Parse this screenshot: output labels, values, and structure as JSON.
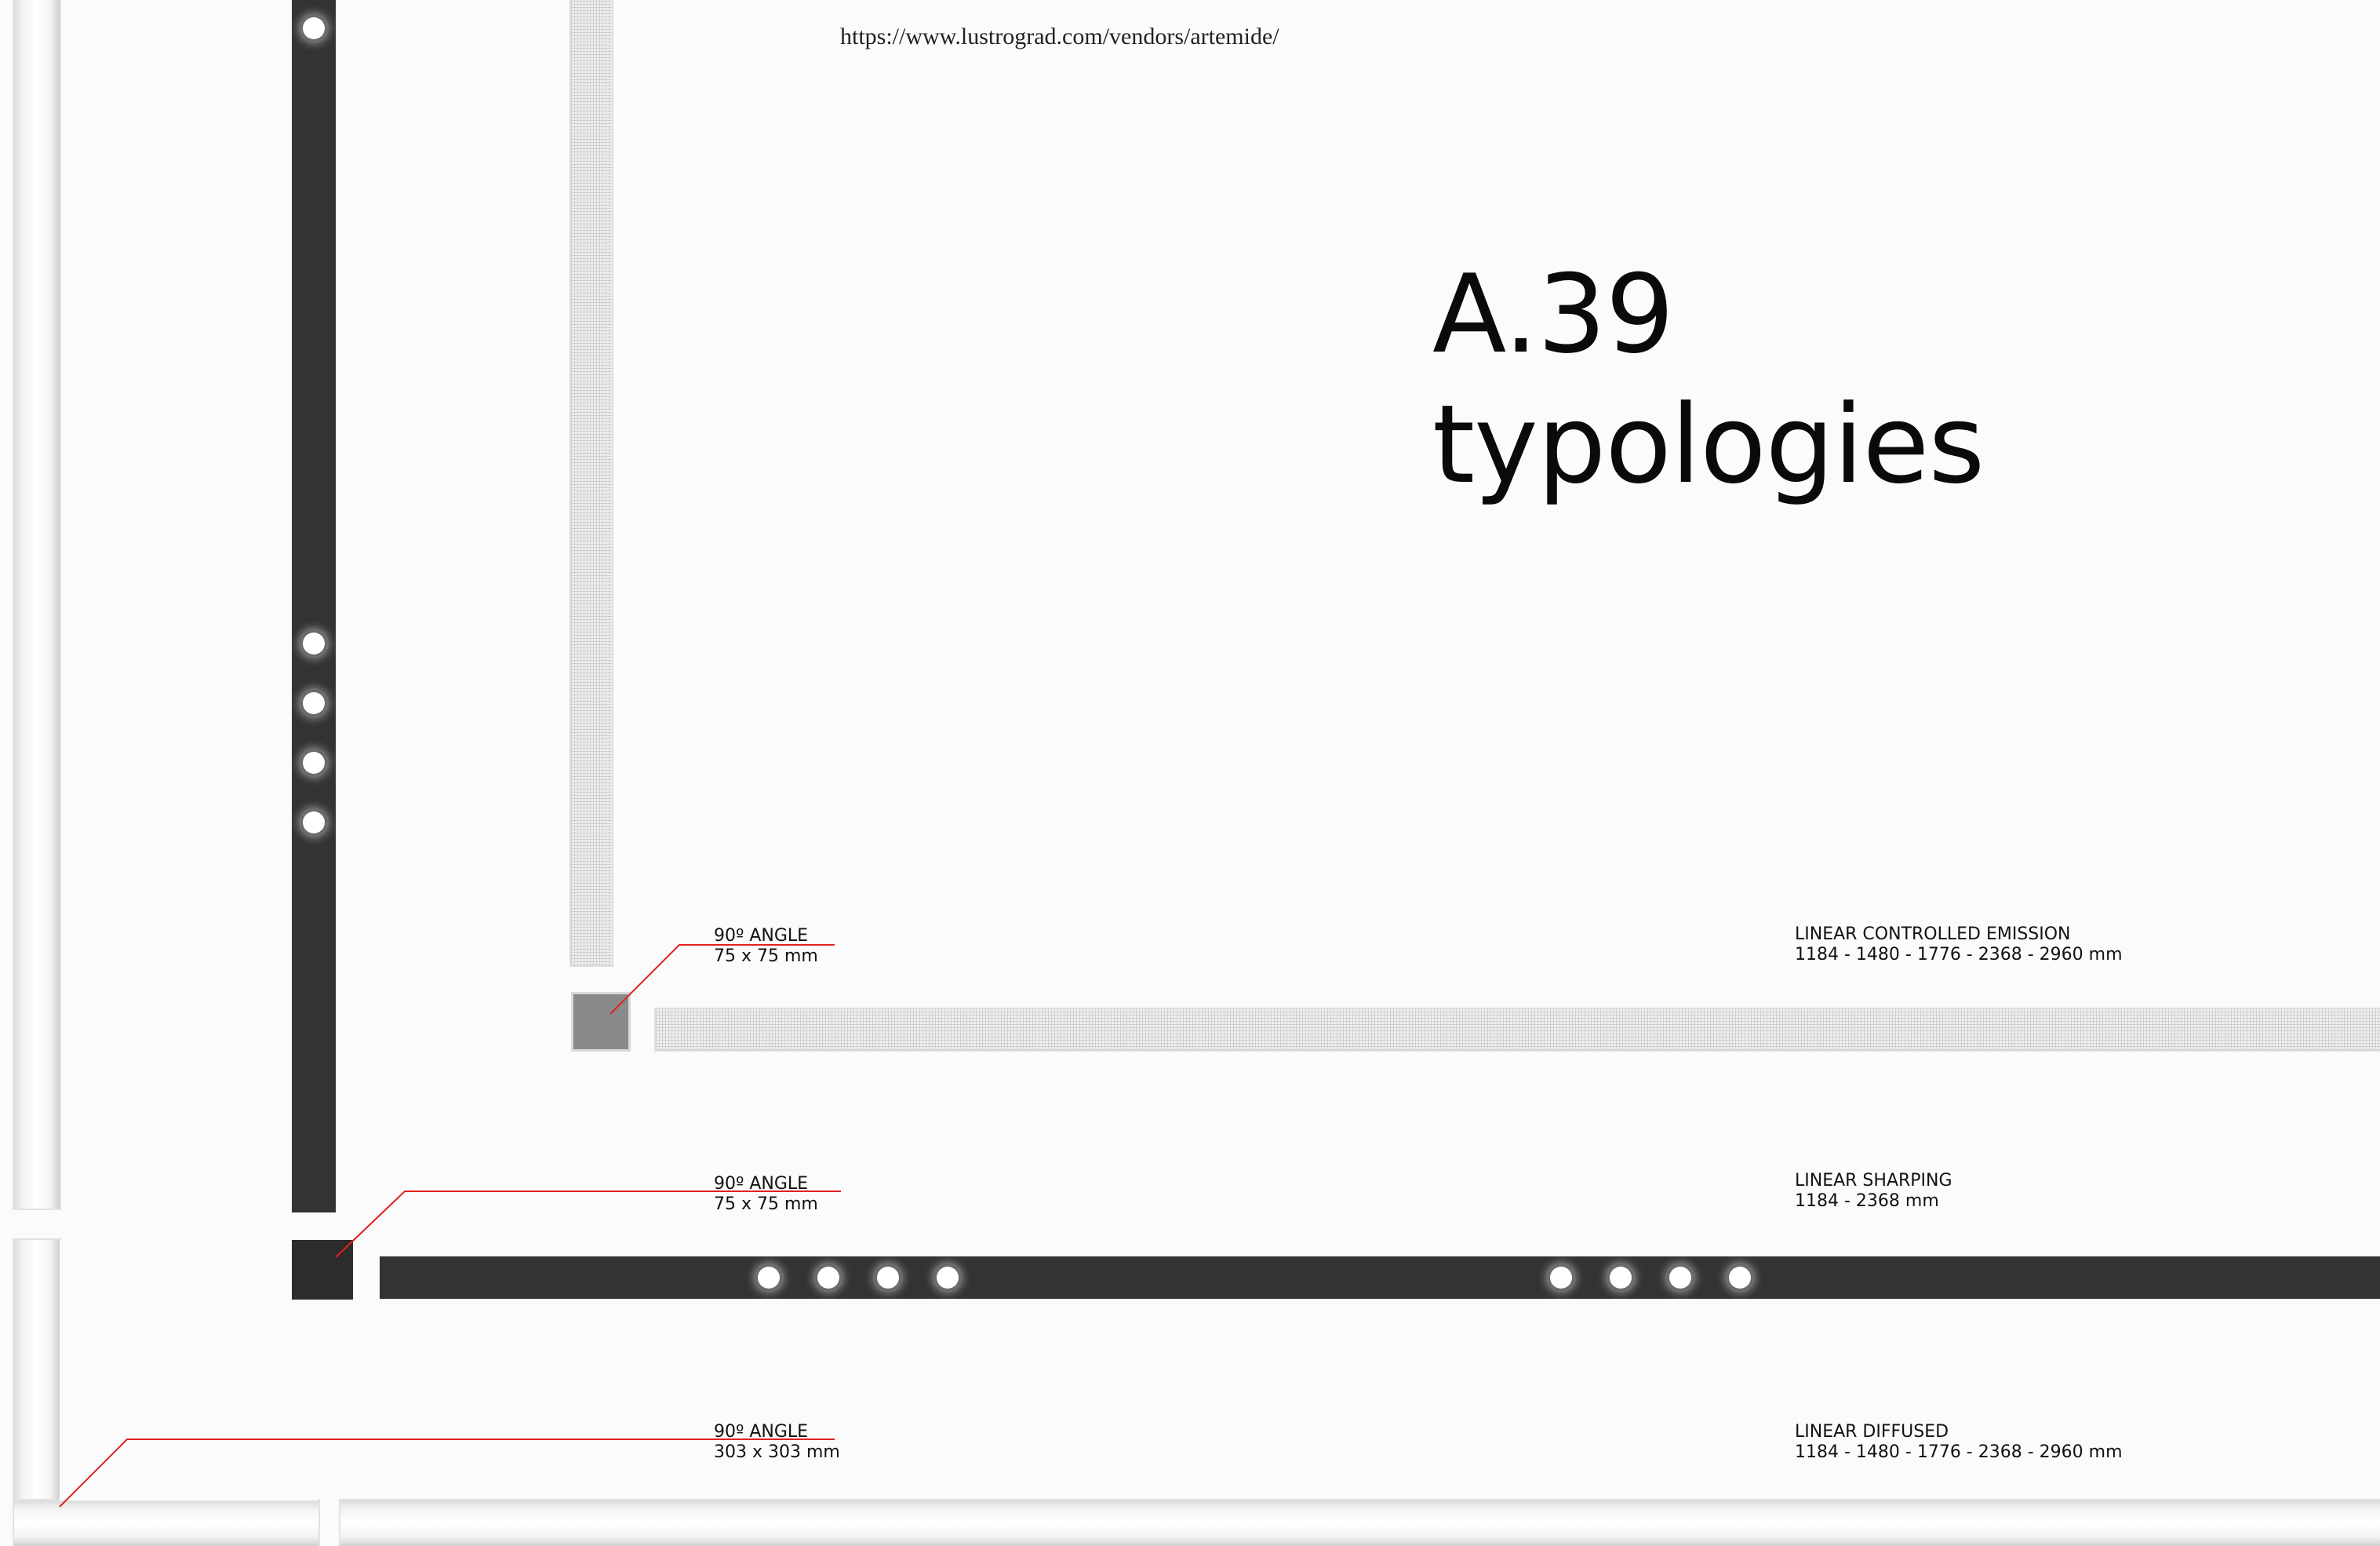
{
  "source_url": "https://www.lustrograd.com/vendors/artemide/",
  "title": {
    "line1": "A.39",
    "line2": "typologies"
  },
  "labels": {
    "angle_mesh": {
      "name": "90º ANGLE",
      "size": "75 x 75 mm"
    },
    "angle_dark": {
      "name": "90º ANGLE",
      "size": "75 x 75 mm"
    },
    "angle_diffused": {
      "name": "90º ANGLE",
      "size": "303 x 303 mm"
    },
    "linear_controlled": {
      "name": "LINEAR CONTROLLED EMISSION",
      "lengths": "1184 - 1480 - 1776 - 2368 - 2960 mm"
    },
    "linear_sharping": {
      "name": "LINEAR SHARPING",
      "lengths": "1184 - 2368 mm"
    },
    "linear_diffused": {
      "name": "LINEAR DIFFUSED",
      "lengths": "1184 - 1480 - 1776 - 2368 - 2960 mm"
    }
  },
  "colors": {
    "leader_line": "#e02020",
    "dark_profile": "#333333",
    "background": "#fbfbfb"
  }
}
